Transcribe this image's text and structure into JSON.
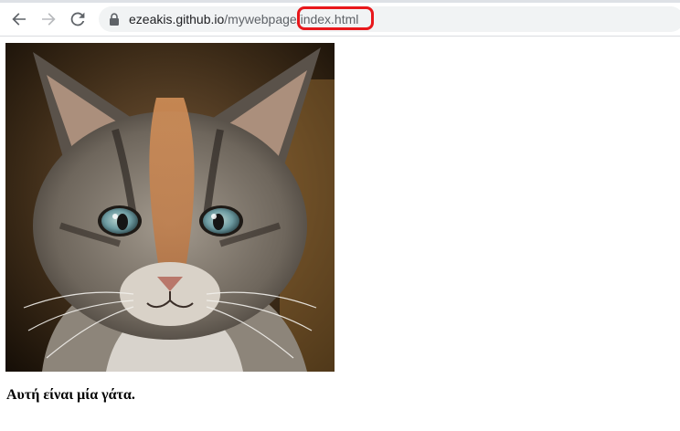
{
  "browser": {
    "url": {
      "host": "ezeakis.github.io",
      "path": "/mywebpage/",
      "file": "index.html"
    },
    "highlight_color": "#e8171b"
  },
  "page": {
    "caption": "Αυτή είναι μία γάτα."
  }
}
